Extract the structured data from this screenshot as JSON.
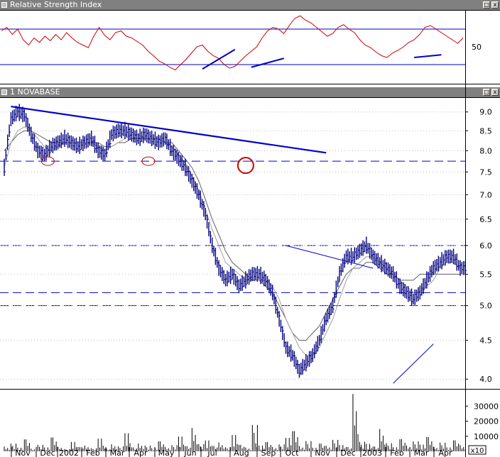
{
  "panels": {
    "rsi": {
      "title": "Relative Strength Index"
    },
    "price": {
      "title": "1 NOVABASE"
    }
  },
  "window_buttons": {
    "minimize": "_",
    "maximize": "□",
    "close": "x"
  },
  "colors": {
    "rsi_line": "#cc0000",
    "trendline": "#0000cc",
    "bars": "#000080",
    "moving_average": "#808080",
    "titlebar": "#808080",
    "annotation_circle": "#cc0000"
  },
  "chart_data": [
    {
      "type": "line",
      "title": "Relative Strength Index",
      "yticks": [
        "50"
      ],
      "reference_levels": [
        70,
        30
      ],
      "ylim": [
        10,
        90
      ],
      "series": [
        {
          "values": [
            68,
            72,
            64,
            70,
            58,
            52,
            60,
            55,
            62,
            57,
            64,
            58,
            66,
            60,
            55,
            52,
            49,
            62,
            72,
            63,
            58,
            66,
            68,
            62,
            60,
            56,
            52,
            45,
            40,
            34,
            31,
            27,
            24,
            30,
            36,
            43,
            50,
            52,
            45,
            40,
            37,
            30,
            26,
            28,
            34,
            40,
            45,
            50,
            60,
            68,
            72,
            70,
            65,
            74,
            82,
            85,
            80,
            77,
            72,
            67,
            62,
            65,
            72,
            75,
            70,
            66,
            58,
            52,
            49,
            44,
            40,
            38,
            43,
            46,
            50,
            55,
            58,
            64,
            72,
            74,
            70,
            66,
            62,
            58,
            54,
            60
          ]
        }
      ],
      "trendlines": [
        {
          "from": [
            37,
            25
          ],
          "to": [
            43,
            47
          ]
        },
        {
          "from": [
            46,
            27
          ],
          "to": [
            52,
            37
          ]
        },
        {
          "from": [
            76,
            38
          ],
          "to": [
            81,
            41
          ]
        }
      ]
    },
    {
      "type": "bar",
      "title": "1 NOVABASE",
      "scale": "log",
      "ylim": [
        3.9,
        9.35
      ],
      "yticks": [
        "9.0",
        "8.5",
        "8.0",
        "7.5",
        "7.0",
        "6.5",
        "6.0",
        "5.5",
        "5.0",
        "4.5",
        "4.0"
      ],
      "xtick_labels": [
        "Nov",
        "Dec",
        "2002",
        "Feb",
        "Mar",
        "Apr",
        "May",
        "Jun",
        "Jul",
        "Aug",
        "Sep",
        "Oct",
        "Nov",
        "Dec",
        "2003",
        "Feb",
        "Mar",
        "Apr"
      ],
      "close": [
        7.6,
        8.8,
        9.0,
        8.9,
        8.4,
        8.0,
        7.9,
        8.1,
        8.2,
        8.3,
        8.2,
        8.1,
        8.2,
        8.3,
        8.0,
        7.9,
        8.4,
        8.5,
        8.5,
        8.4,
        8.3,
        8.4,
        8.3,
        8.2,
        8.3,
        8.0,
        7.8,
        7.6,
        7.3,
        7.0,
        6.6,
        6.0,
        5.6,
        5.4,
        5.5,
        5.3,
        5.4,
        5.5,
        5.5,
        5.4,
        5.2,
        4.8,
        4.4,
        4.3,
        4.1,
        4.2,
        4.3,
        4.5,
        4.8,
        5.0,
        5.5,
        5.8,
        5.8,
        5.9,
        6.0,
        5.8,
        5.7,
        5.6,
        5.5,
        5.3,
        5.2,
        5.1,
        5.2,
        5.4,
        5.6,
        5.7,
        5.8,
        5.8,
        5.6
      ],
      "moving_average_fast": [
        7.6,
        8.2,
        8.5,
        8.6,
        8.5,
        8.3,
        8.1,
        8.0,
        8.1,
        8.2,
        8.2,
        8.2,
        8.2,
        8.2,
        8.1,
        8.0,
        8.1,
        8.2,
        8.3,
        8.4,
        8.4,
        8.3,
        8.3,
        8.3,
        8.2,
        8.1,
        7.9,
        7.7,
        7.4,
        7.1,
        6.7,
        6.3,
        6.0,
        5.7,
        5.6,
        5.5,
        5.4,
        5.4,
        5.4,
        5.4,
        5.3,
        5.1,
        4.8,
        4.6,
        4.4,
        4.3,
        4.3,
        4.4,
        4.6,
        4.8,
        5.1,
        5.4,
        5.6,
        5.7,
        5.8,
        5.8,
        5.7,
        5.6,
        5.5,
        5.4,
        5.3,
        5.2,
        5.2,
        5.3,
        5.4,
        5.6,
        5.7,
        5.7,
        5.6
      ],
      "moving_average_slow": [
        8.0,
        8.2,
        8.4,
        8.5,
        8.5,
        8.4,
        8.3,
        8.2,
        8.2,
        8.2,
        8.2,
        8.2,
        8.2,
        8.2,
        8.2,
        8.1,
        8.1,
        8.2,
        8.2,
        8.3,
        8.3,
        8.3,
        8.3,
        8.3,
        8.2,
        8.2,
        8.0,
        7.8,
        7.6,
        7.3,
        6.9,
        6.5,
        6.2,
        5.9,
        5.7,
        5.6,
        5.5,
        5.4,
        5.4,
        5.3,
        5.2,
        5.0,
        4.8,
        4.6,
        4.5,
        4.5,
        4.6,
        4.7,
        4.9,
        5.1,
        5.3,
        5.5,
        5.6,
        5.6,
        5.7,
        5.7,
        5.6,
        5.5,
        5.5,
        5.4,
        5.4,
        5.4,
        5.5,
        5.5,
        5.5,
        5.5,
        5.5,
        5.5,
        5.5
      ],
      "horizontal_levels": [
        7.75,
        6.0,
        5.2,
        5.0
      ],
      "trendlines": [
        {
          "from": [
            1,
            9.15
          ],
          "to": [
            48,
            7.95
          ]
        },
        {
          "from": [
            42,
            6.0
          ],
          "to": [
            55,
            5.6
          ]
        },
        {
          "from": [
            58,
            3.95
          ],
          "to": [
            64,
            4.45
          ]
        }
      ],
      "annotation_circles": [
        {
          "x": 6.5,
          "y": 7.75,
          "kind": "small"
        },
        {
          "x": 21.5,
          "y": 7.75,
          "kind": "small"
        },
        {
          "x": 36,
          "y": 7.75,
          "kind": "large"
        }
      ]
    },
    {
      "type": "bar",
      "title": "Volume",
      "ylim": [
        0,
        40000
      ],
      "yticks": [
        "30000",
        "20000",
        "10000"
      ],
      "unit_label": "x10",
      "values": [
        3200,
        5100,
        2400,
        7900,
        1800,
        4300,
        2600,
        9200,
        3100,
        1500,
        6200,
        2800,
        3900,
        2100,
        8400,
        1900,
        4700,
        3300,
        12000,
        2600,
        5200,
        3800,
        2200,
        6600,
        2900,
        4100,
        9800,
        3400,
        15500,
        4800,
        7200,
        3600,
        5900,
        2700,
        10800,
        4300,
        2500,
        17500,
        3800,
        6100,
        2900,
        4600,
        8900,
        13400,
        3500,
        6800,
        2400,
        5100,
        3700,
        7600,
        4200,
        2800,
        38000,
        6300,
        4900,
        3200,
        14800,
        5400,
        2700,
        8100,
        3900,
        6600,
        4400,
        9500,
        3100,
        5700,
        2600,
        7300,
        4100
      ]
    }
  ]
}
